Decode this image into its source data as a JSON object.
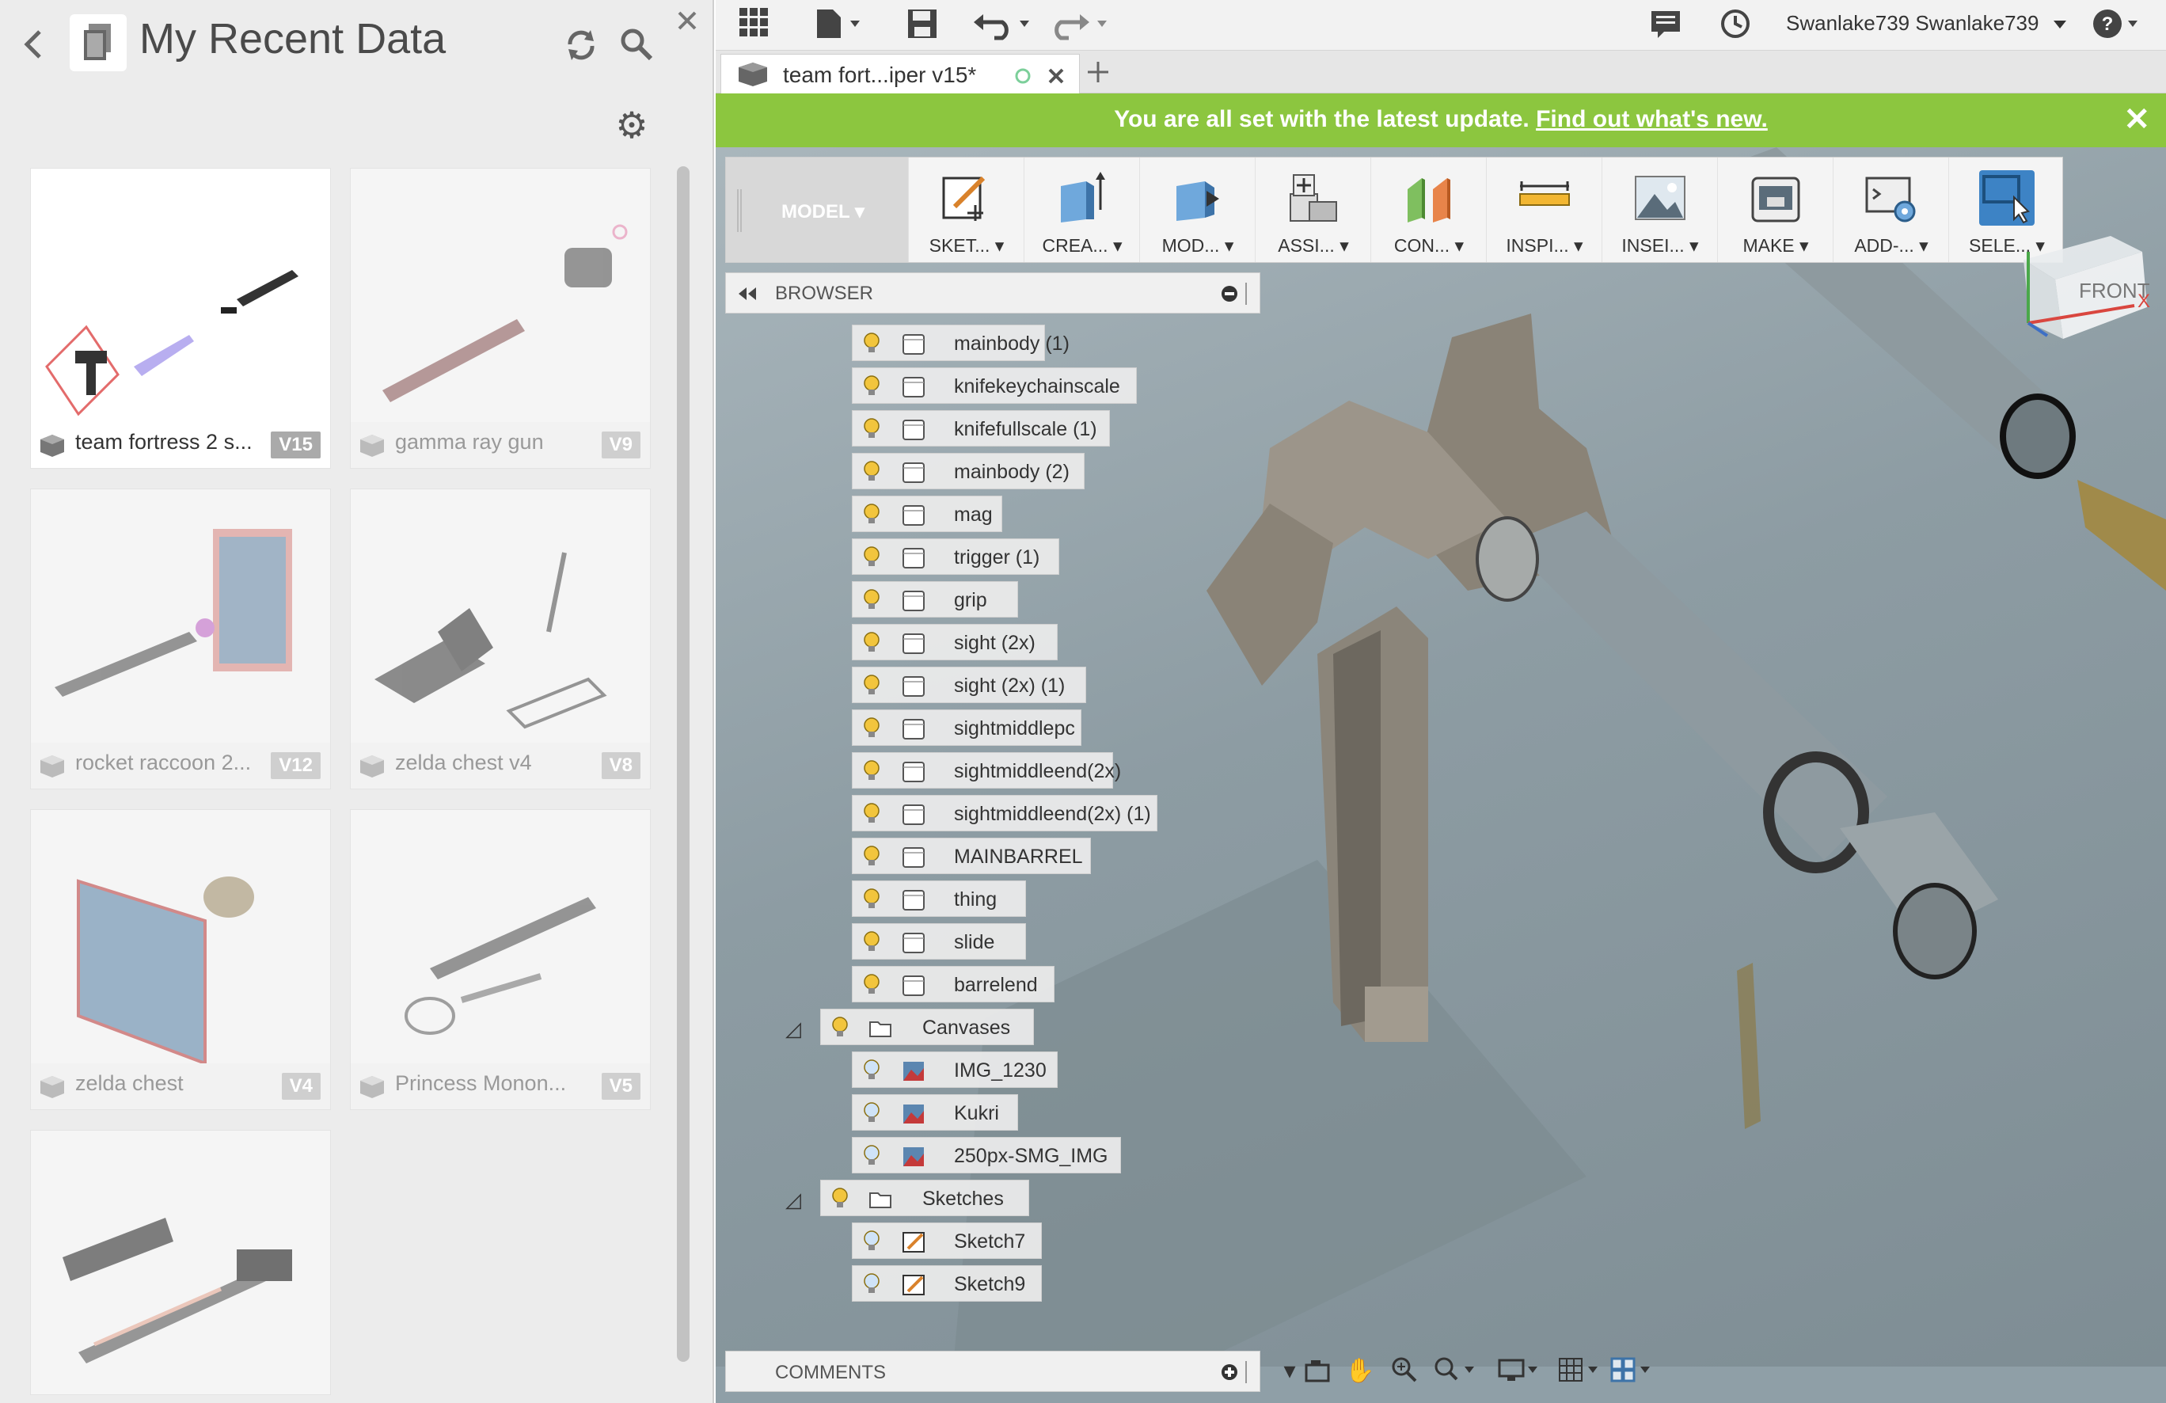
{
  "left_panel": {
    "title": "My Recent Data",
    "items": [
      {
        "name": "team fortress 2 s...",
        "version": "V15"
      },
      {
        "name": "gamma ray gun",
        "version": "V9"
      },
      {
        "name": "rocket raccoon 2...",
        "version": "V12"
      },
      {
        "name": "zelda chest v4",
        "version": "V8"
      },
      {
        "name": "zelda chest",
        "version": "V4"
      },
      {
        "name": "Princess Monon...",
        "version": "V5"
      },
      {
        "name": "",
        "version": ""
      }
    ]
  },
  "topbar": {
    "user": "Swanlake739 Swanlake739"
  },
  "document_tab": {
    "label": "team fort...iper v15*"
  },
  "banner": {
    "message": "You are all set with the latest update.",
    "link": "Find out what's new."
  },
  "toolbar": {
    "workspace": "MODEL",
    "tools": [
      {
        "label": "SKET...",
        "icon": "sketch-icon"
      },
      {
        "label": "CREA...",
        "icon": "create-icon"
      },
      {
        "label": "MOD...",
        "icon": "modify-icon"
      },
      {
        "label": "ASSI...",
        "icon": "assemble-icon"
      },
      {
        "label": "CON...",
        "icon": "construct-icon"
      },
      {
        "label": "INSPI...",
        "icon": "inspect-icon"
      },
      {
        "label": "INSEI...",
        "icon": "insert-icon"
      },
      {
        "label": "MAKE",
        "icon": "make-icon"
      },
      {
        "label": "ADD-...",
        "icon": "addins-icon"
      },
      {
        "label": "SELE...",
        "icon": "select-icon"
      }
    ]
  },
  "browser": {
    "title": "BROWSER",
    "bodies": [
      "mainbody (1)",
      "knifekeychainscale",
      "knifefullscale (1)",
      "mainbody (2)",
      "mag",
      "trigger (1)",
      "grip",
      "sight (2x)",
      "sight (2x) (1)",
      "sightmiddlepc",
      "sightmiddleend(2x)",
      "sightmiddleend(2x) (1)",
      "MAINBARREL",
      "thing",
      "slide",
      "barrelend"
    ],
    "canvases_label": "Canvases",
    "canvases": [
      "IMG_1230",
      "Kukri",
      "250px-SMG_IMG"
    ],
    "sketches_label": "Sketches",
    "sketches": [
      "Sketch7",
      "Sketch9"
    ]
  },
  "comments": {
    "title": "COMMENTS"
  },
  "viewcube": {
    "face": "FRONT",
    "axis_x": "X"
  },
  "colors": {
    "banner": "#8cc63f",
    "select_accent": "#3d83c5",
    "bulb": "#f2c53d"
  }
}
